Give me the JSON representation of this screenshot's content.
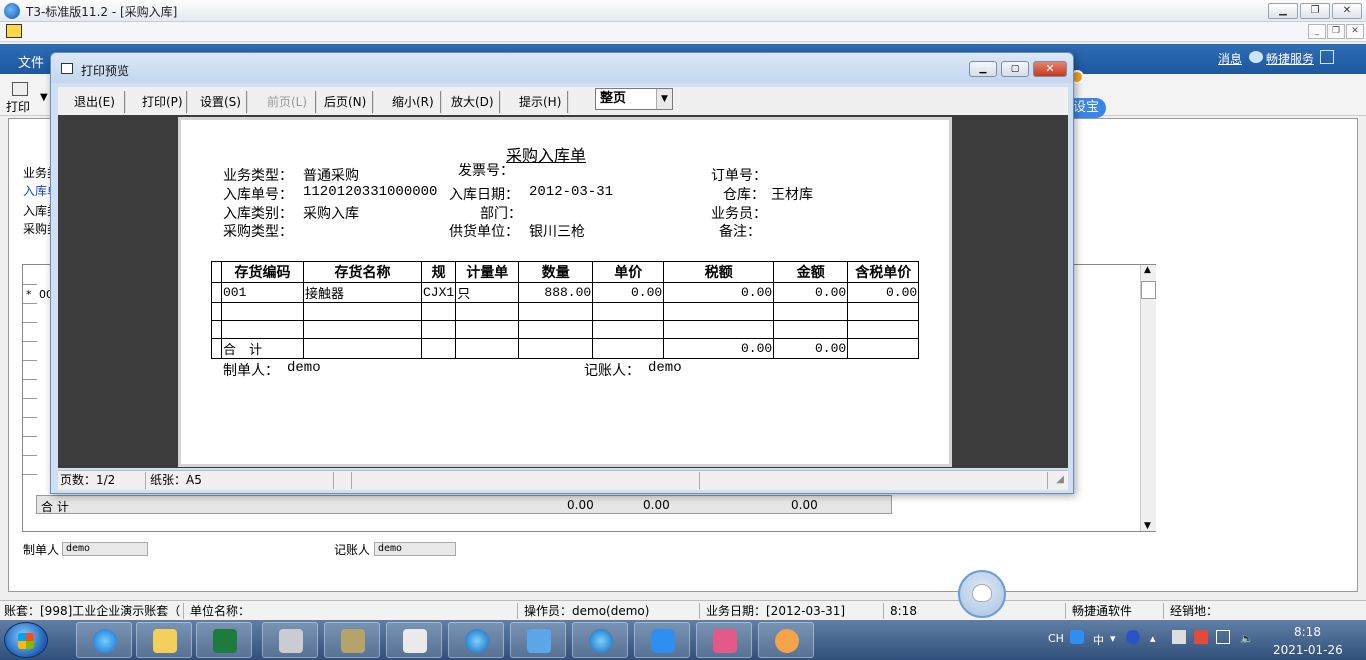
{
  "app": {
    "title": "T3-标准版11.2 - [采购入库]"
  },
  "menubar": {
    "file": "文件",
    "messages": "消息",
    "service": "畅捷服务"
  },
  "bg_toolbar": {
    "print": "打印",
    "pill": "设宝"
  },
  "bg_doc": {
    "labels": [
      "业务类",
      "入库单",
      "入库类",
      "采购类"
    ],
    "grid_rows": [
      [
        "*",
        "00"
      ]
    ],
    "total_label": "合  计",
    "total_values": [
      "0.00",
      "0.00",
      "0.00"
    ],
    "maker_label": "制单人",
    "maker_value": "demo",
    "keeper_label": "记账人",
    "keeper_value": "demo"
  },
  "preview": {
    "title": "打印预览",
    "toolbar": {
      "exit": "退出(E)",
      "print": "打印(P)",
      "setup": "设置(S)",
      "prev": "前页(L)",
      "next": "后页(N)",
      "zoom_out": "缩小(R)",
      "zoom_in": "放大(D)",
      "hint": "提示(H)",
      "view_mode": "整页"
    },
    "status": {
      "pages": "页数：1/2",
      "paper": "纸张：A5"
    }
  },
  "report": {
    "title": "采购入库单",
    "business_type_label": "业务类型：",
    "business_type": "普通采购",
    "invoice_label": "发票号：",
    "invoice": "",
    "order_label": "订单号：",
    "order": "",
    "entry_no_label": "入库单号：",
    "entry_no": "1120120331000000",
    "entry_date_label": "入库日期：",
    "entry_date": "2012-03-31",
    "warehouse_label": "仓库：",
    "warehouse": "王材库",
    "entry_type_label": "入库类别：",
    "entry_type": "采购入库",
    "dept_label": "部门：",
    "dept": "",
    "clerk_label": "业务员：",
    "clerk": "",
    "purchase_type_label": "采购类型：",
    "purchase_type": "",
    "supplier_label": "供货单位：",
    "supplier": "银川三枪",
    "note_label": "备注：",
    "note": "",
    "columns": [
      "存货编码",
      "存货名称",
      "规",
      "计量单",
      "数量",
      "单价",
      "税额",
      "金额",
      "含税单价"
    ],
    "rows": [
      [
        "001",
        "接触器",
        "CJX1",
        "只",
        "888.00",
        "0.00",
        "0.00",
        "0.00",
        "0.00"
      ],
      [
        "",
        "",
        "",
        "",
        "",
        "",
        "",
        "",
        ""
      ],
      [
        "",
        "",
        "",
        "",
        "",
        "",
        "",
        "",
        ""
      ]
    ],
    "total_label": "合　计",
    "total_tax": "0.00",
    "total_amount": "0.00",
    "maker_label": "制单人：",
    "maker": "demo",
    "keeper_label": "记账人：",
    "keeper": "demo"
  },
  "app_status": {
    "account": "账套：[998]工业企业演示账套（",
    "unit": "单位名称：",
    "operator": "操作员：demo(demo)",
    "biz_date": "业务日期：[2012-03-31]",
    "time": "8:18",
    "brand": "畅捷通软件",
    "dealer": "经销地："
  },
  "taskbar": {
    "apps": [
      "ie-icon",
      "folder-icon",
      "excel-icon",
      "tools-icon",
      "setup-icon",
      "notepad-icon",
      "ie-alt-icon",
      "paper-plane-icon",
      "ie-blue-icon",
      "qq-browser-icon",
      "game-icon",
      "monkey-icon"
    ],
    "tray_lang": "CH",
    "tray_ime": "中",
    "time": "8:18",
    "date": "2021-01-26"
  }
}
